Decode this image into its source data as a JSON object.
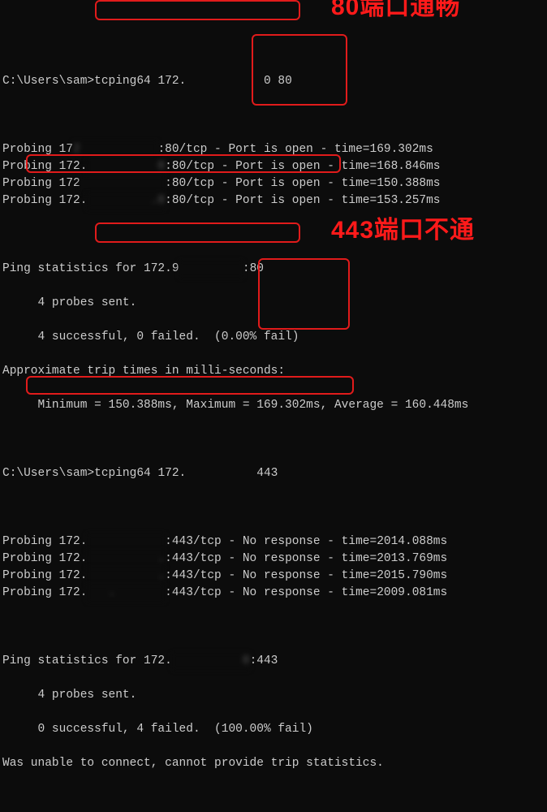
{
  "prompt": "C:\\Users\\sam>",
  "cmd1": "tcping64 172.           0 80",
  "anno1": "80端口通畅",
  "probes1": [
    {
      "pre": "Probing 17",
      "mask": "2           ",
      "suf": ":80/tcp - ",
      "status": "Port is open",
      "time": " - time=169.302ms"
    },
    {
      "pre": "Probing 172.",
      "mask": "          0",
      "suf": ":80/tcp - ",
      "status": "Port is open",
      "time": " - time=168.846ms"
    },
    {
      "pre": "Probing 172",
      "mask": "            ",
      "suf": ":80/tcp - ",
      "status": "Port is open",
      "time": " - time=150.388ms"
    },
    {
      "pre": "Probing 172.",
      "mask": "         .0",
      "suf": ":80/tcp - ",
      "status": "Port is open",
      "time": " - time=153.257ms"
    }
  ],
  "stats1_header": "Ping statistics for 172.9",
  "stats1_mask": "         ",
  "stats1_tail": ":80",
  "stats1_sent": "     4 probes sent.",
  "stats1_result": "     4 successful, 0 failed.  (0.00% fail)",
  "approx_header": "Approximate trip times in milli-seconds:",
  "approx_detail": "     Minimum = 150.388ms, Maximum = 169.302ms, Average = 160.448ms",
  "cmd2": "tcping64 172.          443",
  "anno2": "443端口不通",
  "probes2": [
    {
      "pre": "Probing 172.",
      "mask": "           ",
      "suf": ":443/tcp - ",
      "status": "No response",
      "time": " - time=2014.088ms"
    },
    {
      "pre": "Probing 172.",
      "mask": "          .",
      "suf": ":443/tcp - ",
      "status": "No response",
      "time": " - time=2013.769ms"
    },
    {
      "pre": "Probing 172.",
      "mask": "          .",
      "suf": ":443/tcp - ",
      "status": "No response",
      "time": " - time=2015.790ms"
    },
    {
      "pre": "Probing 172.",
      "mask": "   .       ",
      "suf": ":443/tcp - ",
      "status": "No response",
      "time": " - time=2009.081ms"
    }
  ],
  "stats2_header": "Ping statistics for 172.",
  "stats2_mask": "          0",
  "stats2_tail": ":443",
  "stats2_sent": "     4 probes sent.",
  "stats2_result": "     0 successful, 4 failed.  (100.00% fail)",
  "unable": "Was unable to connect, cannot provide trip statistics."
}
